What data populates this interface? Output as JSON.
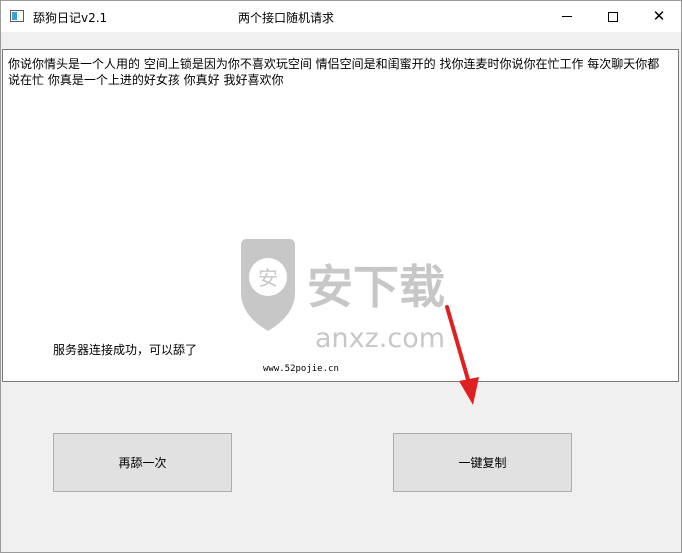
{
  "window": {
    "title": "舔狗日记v2.1",
    "center_title": "两个接口随机请求",
    "controls": {
      "minimize": "minimize-icon",
      "maximize": "maximize-icon",
      "close": "close-icon"
    }
  },
  "main": {
    "content": "你说你情头是一个人用的 空间上锁是因为你不喜欢玩空间 情侣空间是和闺蜜开的 找你连麦时你说你在忙工作 每次聊天你都说在忙 你真是一个上进的好女孩 你真好 我好喜欢你",
    "status": "服务器连接成功，可以舔了",
    "site": "www.52pojie.cn"
  },
  "watermark": {
    "brand_text": "安下载",
    "domain": "anxz.com",
    "shield_char": "安"
  },
  "buttons": {
    "again": "再舔一次",
    "copy": "一键复制"
  },
  "colors": {
    "arrow": "#e02020",
    "watermark": "#9a9a9a"
  }
}
